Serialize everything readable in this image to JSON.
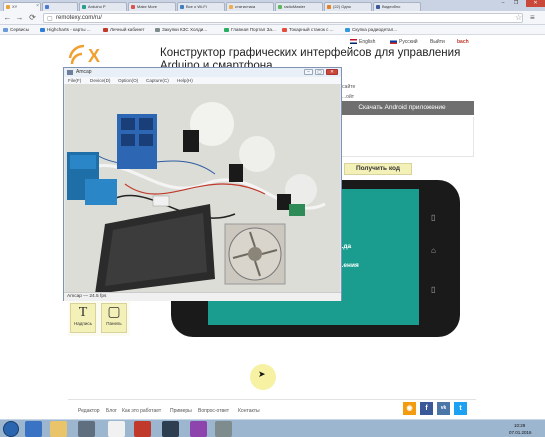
{
  "browser": {
    "tabs": [
      {
        "label": "XY",
        "color": "#e8a33c",
        "active": true
      },
      {
        "label": "",
        "color": "#4a7bd0"
      },
      {
        "label": "Arduino P",
        "color": "#2a9d8f"
      },
      {
        "label": "Make More",
        "color": "#d9534f"
      },
      {
        "label": "Все о Wi-Fi",
        "color": "#3f7fbf"
      },
      {
        "label": "статистика",
        "color": "#f0ad4e"
      },
      {
        "label": "radioMaster",
        "color": "#5cb85c"
      },
      {
        "label": "(22) Одно",
        "color": "#e67e22"
      },
      {
        "label": "Видеобло",
        "color": "#3b5998"
      }
    ],
    "window_controls": {
      "minimize": "–",
      "restore": "❐",
      "close": "✕"
    },
    "url": "remotexy.com/ru/",
    "bookmarks": [
      {
        "label": "Сервисы",
        "color": "#6a9bd8"
      },
      {
        "label": "Highcharts - карты ...",
        "color": "#2f7ed8"
      },
      {
        "label": "Личный кабинет",
        "color": "#c0392b"
      },
      {
        "label": "Закупки КЗС Холди...",
        "color": "#7f8c8d"
      },
      {
        "label": "Главная Портал За...",
        "color": "#27ae60"
      },
      {
        "label": "Токарный станок с ...",
        "color": "#e74c3c"
      },
      {
        "label": "Скупка радиодетал...",
        "color": "#3498db"
      }
    ]
  },
  "page": {
    "title_line1": "Конструктор графических интерфейсов для управления",
    "title_line2": "Arduino и смартфона",
    "lang_english": "English",
    "lang_russian": "Русский",
    "exit": "Выйти",
    "user": "bach",
    "site_link": "...ойт",
    "site_link_prefix": "...сайте",
    "download_tab": "Скачать Android приложение",
    "get_code": "Получить код",
    "screen_line1": "...да",
    "screen_line2": "...ения",
    "widget_text_glyph": "T",
    "widget_text_label": "Надпись",
    "widget_panel_label": "Панель",
    "footer_links": [
      "Редактор",
      "Блог",
      "Как это работает",
      "Примеры",
      "Вопрос-ответ",
      "Контакты"
    ],
    "social": [
      {
        "glyph": "உ",
        "color": "#f39c12",
        "name": "rss-icon"
      },
      {
        "glyph": "f",
        "color": "#3b5998",
        "name": "facebook-icon"
      },
      {
        "glyph": "vk",
        "color": "#4a76a8",
        "name": "vk-icon"
      },
      {
        "glyph": "t",
        "color": "#1da1f2",
        "name": "twitter-icon"
      }
    ]
  },
  "amcap": {
    "title": "Amcap",
    "menu": [
      "File(F)",
      "Device(D)",
      "Option(O)",
      "Capture(C)",
      "Help(H)"
    ],
    "status": "Amcap — 24.5 fps"
  },
  "taskbar": {
    "time": "10:29",
    "date": "07.01.2016"
  }
}
